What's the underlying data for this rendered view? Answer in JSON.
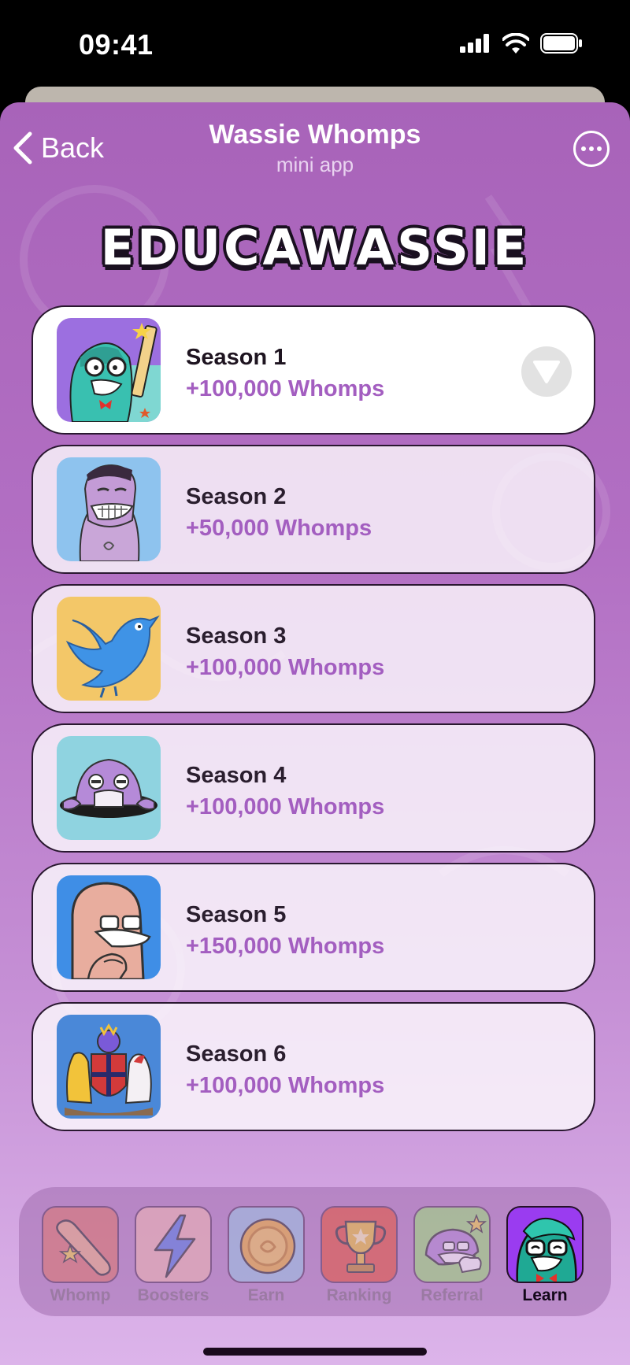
{
  "status_bar": {
    "time": "09:41",
    "icons": [
      "signal-icon",
      "wifi-icon",
      "battery-icon"
    ]
  },
  "header": {
    "back_label": "Back",
    "title": "Wassie Whomps",
    "subtitle": "mini app"
  },
  "headline": "EDUCAWASSIE",
  "seasons": [
    {
      "name": "Season 1",
      "reward": "+100,000 Whomps",
      "thumb": "teacher-wassie-icon",
      "active": true
    },
    {
      "name": "Season 2",
      "reward": "+50,000 Whomps",
      "thumb": "grinning-wassie-icon",
      "active": false
    },
    {
      "name": "Season 3",
      "reward": "+100,000 Whomps",
      "thumb": "blue-bird-icon",
      "active": false
    },
    {
      "name": "Season 4",
      "reward": "+100,000 Whomps",
      "thumb": "hole-wassie-icon",
      "active": false
    },
    {
      "name": "Season 5",
      "reward": "+150,000 Whomps",
      "thumb": "thinking-wassie-icon",
      "active": false
    },
    {
      "name": "Season 6",
      "reward": "+100,000 Whomps",
      "thumb": "coat-of-arms-icon",
      "active": false
    }
  ],
  "tabs": [
    {
      "label": "Whomp",
      "icon": "bat-icon",
      "active": false
    },
    {
      "label": "Boosters",
      "icon": "lightning-icon",
      "active": false
    },
    {
      "label": "Earn",
      "icon": "coin-icon",
      "active": false
    },
    {
      "label": "Ranking",
      "icon": "trophy-icon",
      "active": false
    },
    {
      "label": "Referral",
      "icon": "wassie-thumbs-up-icon",
      "active": false
    },
    {
      "label": "Learn",
      "icon": "nerd-wassie-icon",
      "active": true
    }
  ],
  "colors": {
    "accent": "#a35ec0",
    "background": "#b26fc3",
    "card": "#ffffff"
  }
}
